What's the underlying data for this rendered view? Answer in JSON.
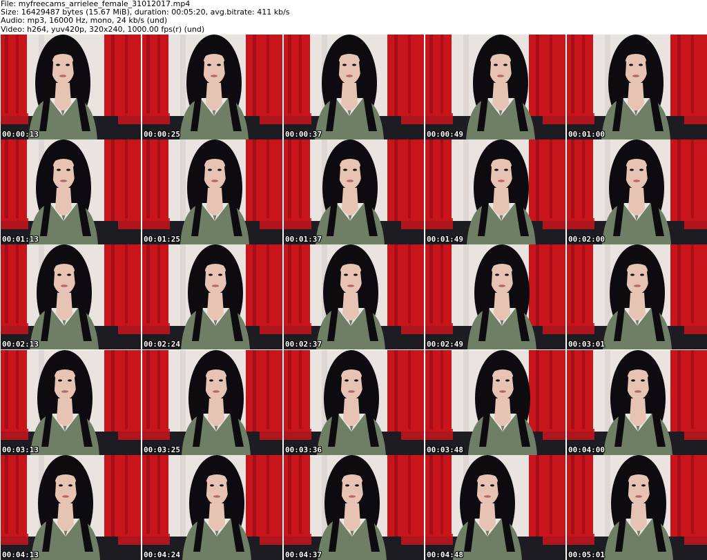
{
  "header": {
    "file_line": "File: myfreecams_arrielee_female_31012017.mp4",
    "size_line": "Size: 16429487 bytes (15.67 MiB), duration: 00:05:20, avg.bitrate: 411 kb/s",
    "audio_line": "Audio: mp3, 16000 Hz, mono, 24 kb/s (und)",
    "video_line": "Video: h264, yuv420p, 320x240, 1000.00 fps(r) (und)"
  },
  "thumbnails": [
    {
      "timestamp": "00:00:13"
    },
    {
      "timestamp": "00:00:25"
    },
    {
      "timestamp": "00:00:37"
    },
    {
      "timestamp": "00:00:49"
    },
    {
      "timestamp": "00:01:00"
    },
    {
      "timestamp": "00:01:13"
    },
    {
      "timestamp": "00:01:25"
    },
    {
      "timestamp": "00:01:37"
    },
    {
      "timestamp": "00:01:49"
    },
    {
      "timestamp": "00:02:00"
    },
    {
      "timestamp": "00:02:13"
    },
    {
      "timestamp": "00:02:24"
    },
    {
      "timestamp": "00:02:37"
    },
    {
      "timestamp": "00:02:49"
    },
    {
      "timestamp": "00:03:01"
    },
    {
      "timestamp": "00:03:13"
    },
    {
      "timestamp": "00:03:25"
    },
    {
      "timestamp": "00:03:36"
    },
    {
      "timestamp": "00:03:48"
    },
    {
      "timestamp": "00:04:00"
    },
    {
      "timestamp": "00:04:13"
    },
    {
      "timestamp": "00:04:24"
    },
    {
      "timestamp": "00:04:37"
    },
    {
      "timestamp": "00:04:48"
    },
    {
      "timestamp": "00:05:01"
    }
  ],
  "colors": {
    "curtain_red": "#c8141b",
    "curtain_dark": "#8e0a10",
    "wall": "#e9e4e0",
    "sofa": "#1c1c22",
    "hair": "#0e0b10",
    "skin": "#e6c3b2",
    "top_green": "#6e7f66",
    "collar": "#e8e6e0"
  }
}
